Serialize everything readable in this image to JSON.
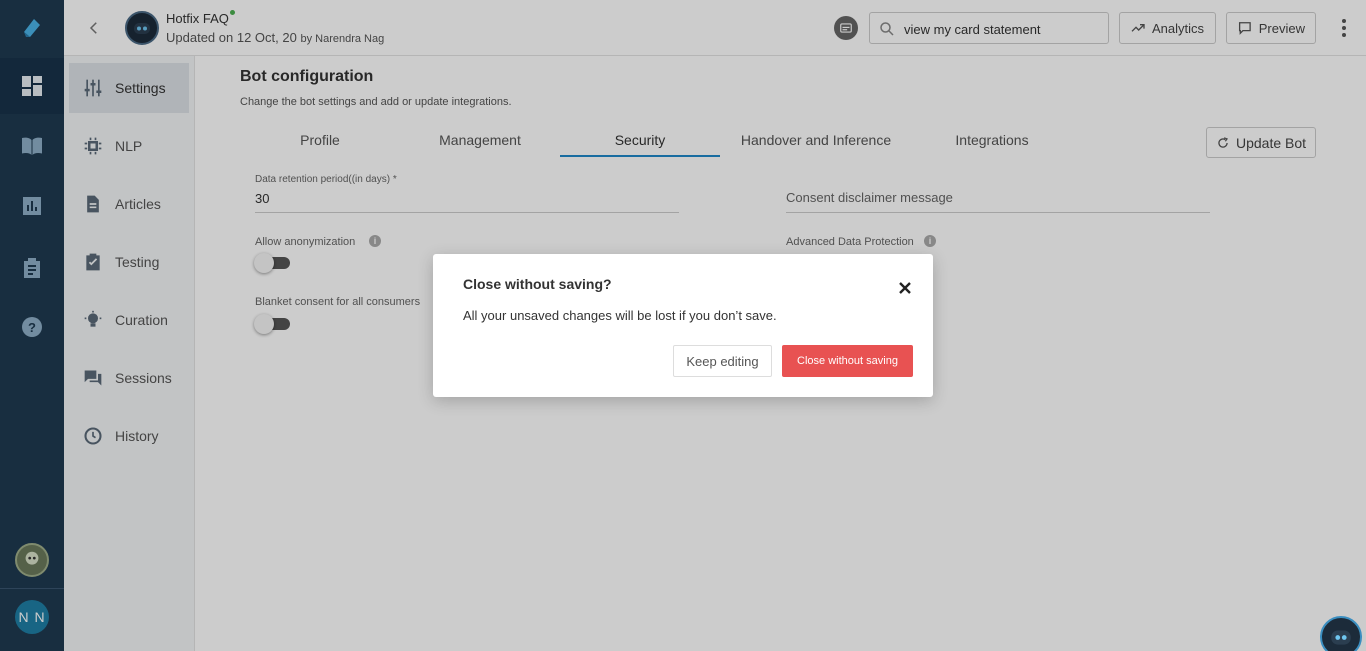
{
  "rail": {
    "icons": [
      "logo-icon",
      "dashboard-icon",
      "knowledge-icon",
      "analytics-icon",
      "clipboard-icon",
      "help-icon"
    ],
    "user_initials": "N N"
  },
  "header": {
    "bot_name": "Hotfix FAQ",
    "updated_prefix": "Updated on",
    "updated_date": "12 Oct, 20",
    "updated_by": "by Narendra Nag",
    "search_value": "view my card statement",
    "analytics_label": "Analytics",
    "preview_label": "Preview"
  },
  "subnav": {
    "items": [
      {
        "label": "Settings",
        "icon": "sliders-icon"
      },
      {
        "label": "NLP",
        "icon": "chip-icon"
      },
      {
        "label": "Articles",
        "icon": "document-icon"
      },
      {
        "label": "Testing",
        "icon": "clipboard-check-icon"
      },
      {
        "label": "Curation",
        "icon": "bulb-icon"
      },
      {
        "label": "Sessions",
        "icon": "chat-icon"
      },
      {
        "label": "History",
        "icon": "history-icon"
      }
    ]
  },
  "main": {
    "title": "Bot configuration",
    "subtitle": "Change the bot settings and add or update integrations.",
    "tabs": [
      {
        "label": "Profile"
      },
      {
        "label": "Management"
      },
      {
        "label": "Security"
      },
      {
        "label": "Handover and Inference"
      },
      {
        "label": "Integrations"
      }
    ],
    "active_tab": "Security",
    "update_bot_label": "Update Bot",
    "fields": {
      "retention_label": "Data retention period((in days) *",
      "retention_value": "30",
      "consent_placeholder": "Consent disclaimer message",
      "anonymization_label": "Allow anonymization",
      "advanced_protection_label": "Advanced Data Protection",
      "blanket_consent_label": "Blanket consent for all consumers"
    }
  },
  "dialog": {
    "title": "Close without saving?",
    "message": "All your unsaved changes will be lost if you don’t save.",
    "keep_editing_label": "Keep editing",
    "close_label": "Close without saving"
  },
  "colors": {
    "rail_bg": "#1f3a50",
    "accent_blue": "#1e88c8",
    "danger": "#e85252"
  }
}
